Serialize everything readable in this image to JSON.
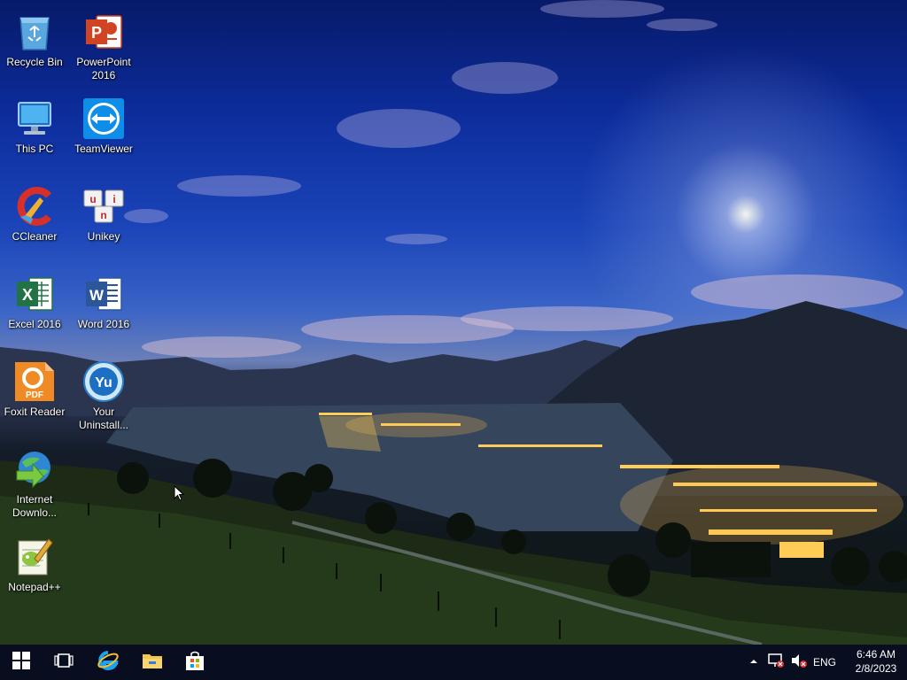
{
  "desktop": {
    "icons": [
      {
        "label": "Recycle Bin",
        "icon": "recycle-bin-icon"
      },
      {
        "label": "PowerPoint 2016",
        "icon": "powerpoint-icon"
      },
      {
        "label": "This PC",
        "icon": "this-pc-icon"
      },
      {
        "label": "TeamViewer",
        "icon": "teamviewer-icon"
      },
      {
        "label": "CCleaner",
        "icon": "ccleaner-icon"
      },
      {
        "label": "Unikey",
        "icon": "unikey-icon"
      },
      {
        "label": "Excel 2016",
        "icon": "excel-icon"
      },
      {
        "label": "Word 2016",
        "icon": "word-icon"
      },
      {
        "label": "Foxit Reader",
        "icon": "foxit-reader-icon"
      },
      {
        "label": "Your Uninstall...",
        "icon": "your-uninstaller-icon"
      },
      {
        "label": "Internet Downlo...",
        "icon": "internet-download-manager-icon"
      },
      {
        "label": "Notepad++",
        "icon": "notepad-plus-plus-icon"
      }
    ],
    "icon_glyph_text": {
      "powerpoint": "P",
      "excel": "X",
      "word": "W",
      "foxit_badge": "PDF",
      "yu": "Yu",
      "unikey_keys": [
        "u",
        "i",
        "n"
      ]
    }
  },
  "taskbar": {
    "start": "windows-start-icon",
    "task_view": "task-view-icon",
    "internet_explorer": "internet-explorer-icon",
    "file_explorer": "file-explorer-icon",
    "store": "store-icon",
    "tray": {
      "show_hidden": "chevron-up-icon",
      "network": "network-no-internet-icon",
      "volume": "volume-muted-icon",
      "language": "ENG"
    },
    "clock": {
      "time": "6:46 AM",
      "date": "2/8/2023"
    }
  },
  "colors": {
    "taskbar_bg": "#0b1220",
    "powerpoint": "#d04423",
    "excel": "#217346",
    "word": "#2b579a",
    "foxit": "#f08a24",
    "teamviewer": "#0e8ee9"
  }
}
